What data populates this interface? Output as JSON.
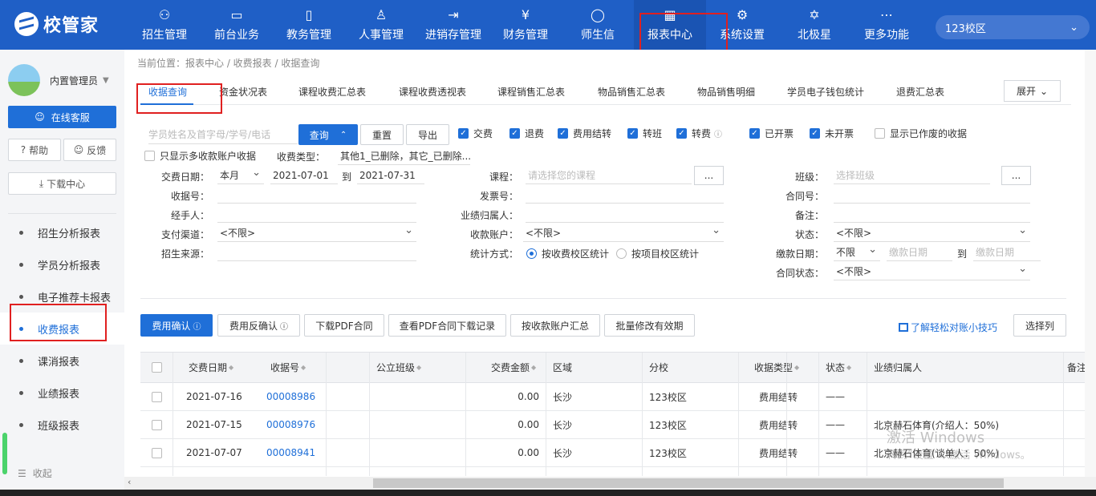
{
  "app": {
    "logo_text": "校管家"
  },
  "nav": [
    {
      "label": "招生管理",
      "icon": "person-add-icon",
      "glyph": "⚇"
    },
    {
      "label": "前台业务",
      "icon": "monitor-icon",
      "glyph": "▭"
    },
    {
      "label": "教务管理",
      "icon": "book-icon",
      "glyph": "▯"
    },
    {
      "label": "人事管理",
      "icon": "person-icon",
      "glyph": "♙"
    },
    {
      "label": "进销存管理",
      "icon": "inventory-icon",
      "glyph": "⇥"
    },
    {
      "label": "财务管理",
      "icon": "money-bag-icon",
      "glyph": "¥"
    },
    {
      "label": "师生信",
      "icon": "chat-icon",
      "glyph": "◯"
    },
    {
      "label": "报表中心",
      "icon": "report-icon",
      "glyph": "▦"
    },
    {
      "label": "系统设置",
      "icon": "gear-icon",
      "glyph": "⚙"
    },
    {
      "label": "北极星",
      "icon": "star-icon",
      "glyph": "✡"
    },
    {
      "label": "更多功能",
      "icon": "more-icon",
      "glyph": "⋯"
    }
  ],
  "campus_select": {
    "value": "123校区"
  },
  "sidebar": {
    "user_name": "内置管理员",
    "online_service": "在线客服",
    "help": "帮助",
    "feedback": "反馈",
    "download_center": "下载中心",
    "items": [
      "招生分析报表",
      "学员分析报表",
      "电子推荐卡报表",
      "收费报表",
      "课消报表",
      "业绩报表",
      "班级报表"
    ],
    "collapse": "收起"
  },
  "breadcrumb": "当前位置：报表中心 / 收费报表 / 收据查询",
  "tabs": [
    "收据查询",
    "资金状况表",
    "课程收费汇总表",
    "课程收费透视表",
    "课程销售汇总表",
    "物品销售汇总表",
    "物品销售明细",
    "学员电子钱包统计",
    "退费汇总表"
  ],
  "expand_label": "展开",
  "filters": {
    "search_placeholder": "学员姓名及首字母/学号/电话",
    "query": "查询",
    "reset": "重置",
    "export": "导出",
    "checkboxes": [
      {
        "label": "交费",
        "checked": true
      },
      {
        "label": "退费",
        "checked": true
      },
      {
        "label": "费用结转",
        "checked": true
      },
      {
        "label": "转班",
        "checked": true
      },
      {
        "label": "转费",
        "checked": true
      },
      {
        "label": "已开票",
        "checked": true
      },
      {
        "label": "未开票",
        "checked": true
      },
      {
        "label": "显示已作废的收据",
        "checked": false
      },
      {
        "label": "只显示多收款账户收据",
        "checked": false
      }
    ],
    "receipt_type_label": "收费类型：",
    "receipt_type_value": "其他1_已删除，其它_已删除...",
    "date_label": "交费日期：",
    "date_period": "本月",
    "date_from": "2021-07-01",
    "date_to_label": "到",
    "date_to": "2021-07-31",
    "course_label": "课程：",
    "course_placeholder": "请选择您的课程",
    "class_label": "班级：",
    "class_placeholder": "选择班级",
    "dots": "...",
    "receipt_no_label": "收据号：",
    "invoice_no_label": "发票号：",
    "contract_no_label": "合同号：",
    "handler_label": "经手人：",
    "performance_label": "业绩归属人：",
    "remark_label": "备注：",
    "payment_channel_label": "支付渠道：",
    "payment_channel_value": "<不限>",
    "account_label": "收款账户：",
    "account_value": "<不限>",
    "status_label": "状态：",
    "status_value": "<不限>",
    "source_label": "招生来源：",
    "stat_method_label": "统计方式：",
    "stat_by_fee_campus": "按收费校区统计",
    "stat_by_item_campus": "按项目校区统计",
    "due_date_label": "缴款日期：",
    "due_period": "不限",
    "due_from_placeholder": "缴款日期",
    "due_to_label": "到",
    "due_to_placeholder": "缴款日期",
    "contract_status_label": "合同状态：",
    "contract_status_value": "<不限>"
  },
  "actions": {
    "confirm": "费用确认",
    "unconfirm": "费用反确认",
    "download_pdf": "下载PDF合同",
    "pdf_log": "查看PDF合同下载记录",
    "by_account": "按收款账户汇总",
    "batch_validity": "批量修改有效期",
    "tip": "了解轻松对账小技巧",
    "select_columns": "选择列"
  },
  "table": {
    "headers": [
      "交费日期",
      "收据号",
      "公立班级",
      "交费金额",
      "区域",
      "分校",
      "收据类型",
      "状态",
      "业绩归属人",
      "备注"
    ],
    "rows": [
      {
        "date": "2021-07-16",
        "receipt": "00008986",
        "public_class": "",
        "amount": "0.00",
        "region": "长沙",
        "campus": "123校区",
        "type": "费用结转",
        "status": "——",
        "performance": ""
      },
      {
        "date": "2021-07-15",
        "receipt": "00008976",
        "public_class": "",
        "amount": "0.00",
        "region": "长沙",
        "campus": "123校区",
        "type": "费用结转",
        "status": "——",
        "performance": "北京赫石体育(介绍人：50%)"
      },
      {
        "date": "2021-07-07",
        "receipt": "00008941",
        "public_class": "",
        "amount": "0.00",
        "region": "长沙",
        "campus": "123校区",
        "type": "费用结转",
        "status": "——",
        "performance": "北京赫石体育(谈单人：50%)"
      }
    ]
  },
  "watermark": {
    "line1": "激活 Windows",
    "line2": "转到“设置”以激活 Windows。"
  },
  "colors": {
    "brand": "#1f5fc6",
    "accent": "#1f6fd8",
    "highlight": "#e02020"
  }
}
